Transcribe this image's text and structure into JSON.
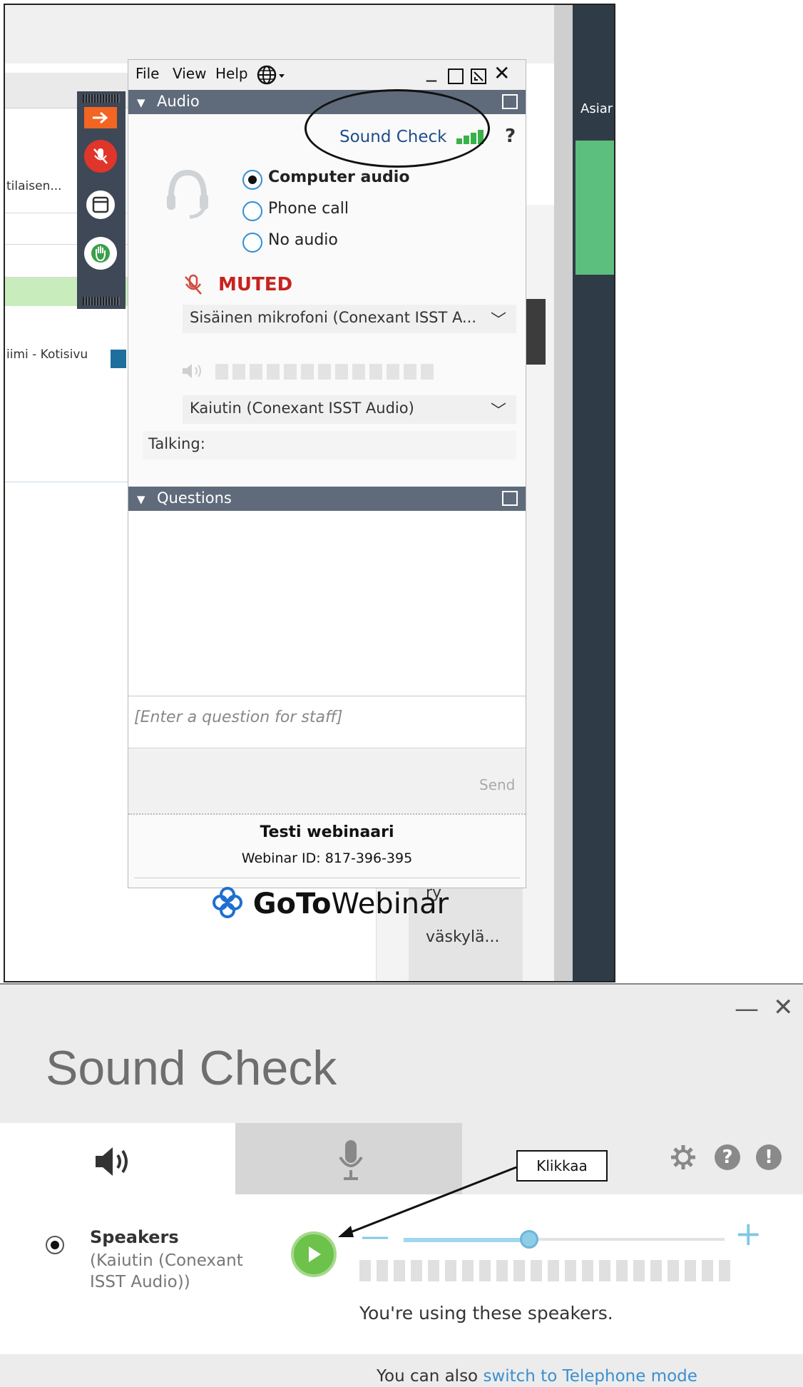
{
  "background_app": {
    "row_labels": [
      "tilaisen...",
      "iimi - Kotisivu"
    ],
    "right_header": "Asiar",
    "list_items": [
      "ry",
      "väskylä..."
    ]
  },
  "gtw": {
    "menu": {
      "file": "File",
      "view": "View",
      "help": "Help"
    },
    "audio_section": "Audio",
    "sound_check_label": "Sound Check",
    "help_label": "?",
    "audio_options": [
      "Computer audio",
      "Phone call",
      "No audio"
    ],
    "selected_option": "Computer audio",
    "muted_label": "MUTED",
    "microphone": "Sisäinen mikrofoni (Conexant ISST A...",
    "speaker": "Kaiutin (Conexant ISST Audio)",
    "talking_label": "Talking:",
    "questions_section": "Questions",
    "question_placeholder": "[Enter a question for staff]",
    "send_label": "Send",
    "webinar_title": "Testi webinaari",
    "webinar_id": "Webinar ID: 817-396-395",
    "logo_bold": "GoTo",
    "logo_light": "Webinar"
  },
  "sound_check": {
    "title": "Sound Check",
    "speaker_name": "Speakers",
    "speaker_device": "(Kaiutin (Conexant ISST Audio))",
    "volume_level": 0.39,
    "status_message": "You're using these speakers.",
    "footer_prefix": "You can also ",
    "footer_link": "switch to Telephone mode",
    "callout": "Klikkaa"
  },
  "colors": {
    "accent_blue": "#1f4c8a",
    "muted_red": "#c8221f",
    "signal_green": "#38b24a",
    "play_green": "#6cc24a",
    "slider_blue": "#8ccde8"
  }
}
